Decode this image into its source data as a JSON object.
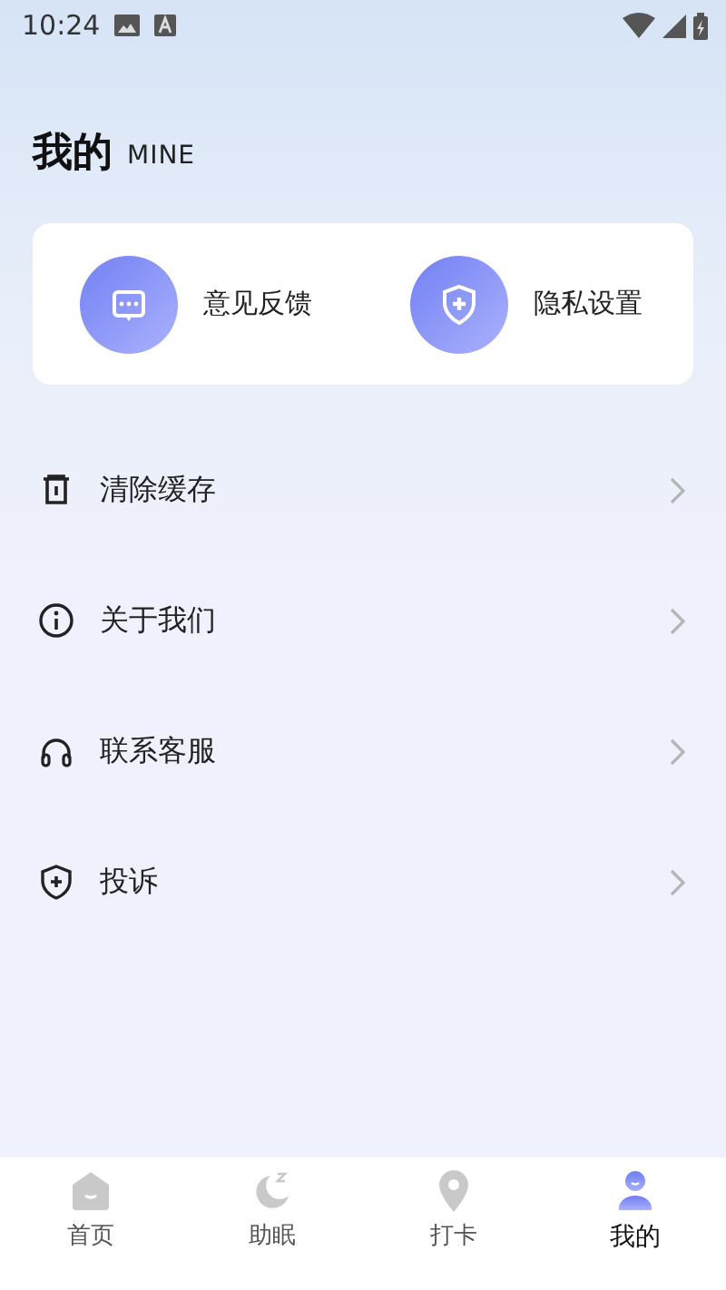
{
  "status_bar": {
    "time": "10:24"
  },
  "header": {
    "title": "我的",
    "subtitle": "MINE"
  },
  "shortcuts": [
    {
      "kind": "feedback",
      "label": "意见反馈"
    },
    {
      "kind": "privacy",
      "label": "隐私设置"
    }
  ],
  "menu": [
    {
      "kind": "trash",
      "label": "清除缓存"
    },
    {
      "kind": "info",
      "label": "关于我们"
    },
    {
      "kind": "headset",
      "label": "联系客服"
    },
    {
      "kind": "shield",
      "label": "投诉"
    }
  ],
  "tabs": [
    {
      "kind": "home",
      "label": "首页",
      "selected": false
    },
    {
      "kind": "sleep",
      "label": "助眠",
      "selected": false
    },
    {
      "kind": "pin",
      "label": "打卡",
      "selected": false
    },
    {
      "kind": "user",
      "label": "我的",
      "selected": true
    }
  ]
}
